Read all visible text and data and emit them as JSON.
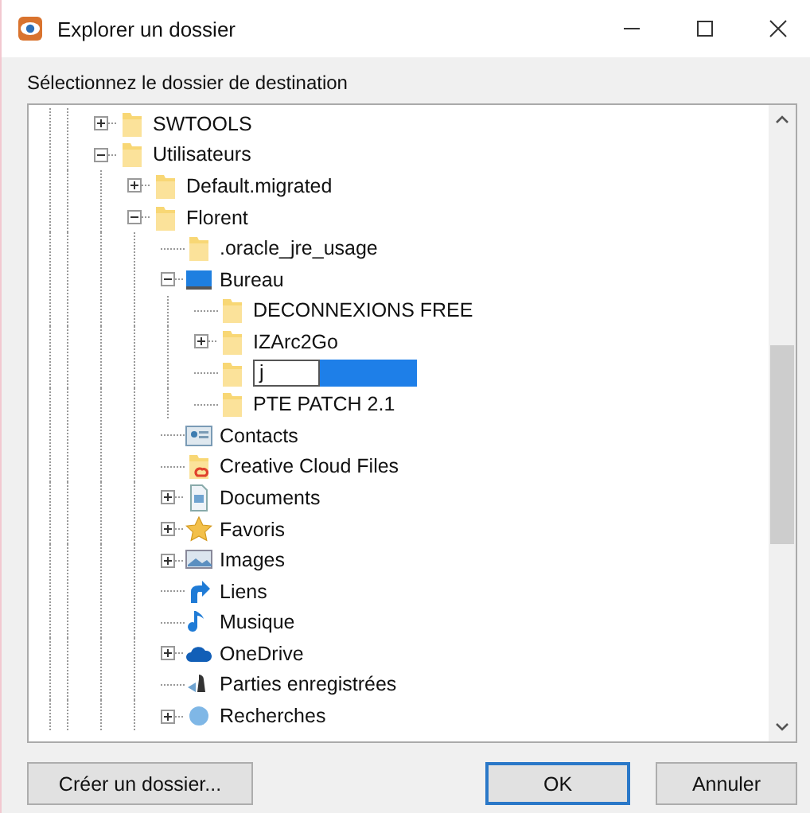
{
  "window": {
    "title": "Explorer un dossier"
  },
  "prompt": "Sélectionnez le dossier de destination",
  "tree": [
    {
      "label": "SWTOOLS",
      "kind": "folder",
      "expanded": false
    },
    {
      "label": "Utilisateurs",
      "kind": "folder",
      "expanded": true,
      "children": [
        {
          "label": "Default.migrated",
          "kind": "folder",
          "expanded": false
        },
        {
          "label": "Florent",
          "kind": "folder",
          "expanded": true,
          "children": [
            {
              "label": ".oracle_jre_usage",
              "kind": "folder"
            },
            {
              "label": "Bureau",
              "kind": "desktop",
              "expanded": true,
              "children": [
                {
                  "label": "DECONNEXIONS FREE",
                  "kind": "folder"
                },
                {
                  "label": "IZArc2Go",
                  "kind": "folder",
                  "expanded": false
                },
                {
                  "value": "j",
                  "kind": "editing"
                },
                {
                  "label": "PTE PATCH 2.1",
                  "kind": "folder"
                }
              ]
            },
            {
              "label": "Contacts",
              "kind": "contacts"
            },
            {
              "label": "Creative Cloud Files",
              "kind": "ccfolder"
            },
            {
              "label": "Documents",
              "kind": "documents",
              "expanded": false
            },
            {
              "label": "Favoris",
              "kind": "star",
              "expanded": false
            },
            {
              "label": "Images",
              "kind": "images",
              "expanded": false
            },
            {
              "label": "Liens",
              "kind": "link"
            },
            {
              "label": "Musique",
              "kind": "music"
            },
            {
              "label": "OneDrive",
              "kind": "cloud",
              "expanded": false
            },
            {
              "label": "Parties enregistrées",
              "kind": "games"
            },
            {
              "label": "Recherches",
              "kind": "search",
              "expanded": false
            }
          ]
        }
      ]
    }
  ],
  "buttons": [
    {
      "label": "Créer un dossier...",
      "kind": "new"
    },
    {
      "label": "OK",
      "kind": "default"
    },
    {
      "label": "Annuler",
      "kind": "cancel"
    }
  ]
}
